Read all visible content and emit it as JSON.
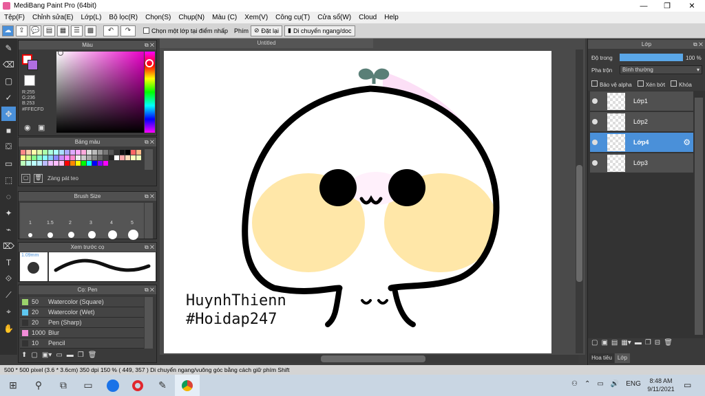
{
  "window": {
    "title": "MediBang Paint Pro (64bit)"
  },
  "menu": [
    "Tệp(F)",
    "Chỉnh sửa(E)",
    "Lớp(L)",
    "Bộ lọc(R)",
    "Chọn(S)",
    "Chụp(N)",
    "Màu (C)",
    "Xem(V)",
    "Công cụ(T)",
    "Cửa sổ(W)",
    "Cloud",
    "Help"
  ],
  "toolbar": {
    "checkbox_label": "Chọn một lớp tại điểm nhấp",
    "phim_label": "Phím",
    "reset_label": "Đặt lại",
    "move_label": "Di chuyển ngang/doc"
  },
  "color_panel": {
    "title": "Màu",
    "r": "R:255",
    "g": "G:236",
    "b": "B:253",
    "hex": "#FFECFD",
    "primary_color": "#ffecfd"
  },
  "palette_panel": {
    "title": "Bảng màu",
    "add_label": "Zàng pát teo"
  },
  "brush_size_panel": {
    "title": "Brush Size",
    "sizes": [
      "1",
      "1.5",
      "2",
      "3",
      "4",
      "5"
    ]
  },
  "preview_panel": {
    "title": "Xem trước cọ",
    "size": "1.09mm"
  },
  "brush_panel": {
    "title": "Cọ: Pen",
    "items": [
      {
        "size": "50",
        "name": "Watercolor (Square)",
        "color": "#9bd36b"
      },
      {
        "size": "20",
        "name": "Watercolor (Wet)",
        "color": "#5ec7f0"
      },
      {
        "size": "20",
        "name": "Pen (Sharp)",
        "color": "#333333"
      },
      {
        "size": "1000",
        "name": "Blur",
        "color": "#f28cd8"
      },
      {
        "size": "10",
        "name": "Pencil",
        "color": "#333333"
      }
    ]
  },
  "document": {
    "tab_title": "Untitled",
    "text_line1": "HuynhThienn",
    "text_line2": "#Hoidap247"
  },
  "layer_panel": {
    "title": "Lớp",
    "opacity_label": "Độ trong",
    "opacity_value": "100 %",
    "opacity_fraction": 1.0,
    "blend_label": "Pha trộn",
    "blend_value": "Bình thường",
    "protect_alpha": "Bảo vệ alpha",
    "clip": "Xén bớt",
    "lock": "Khóa",
    "layers": [
      "Lớp1",
      "Lớp2",
      "Lớp4",
      "Lớp3"
    ],
    "selected": "Lớp4",
    "tabs": [
      "Hoa tiêu",
      "Lớp"
    ]
  },
  "status": {
    "text": "500 * 500 pixel   (3.6 * 3.6cm)   350 dpi   150 %   ( 449, 357 )   Di chuyển ngang/vuông góc bằng cách giữ phím Shift"
  },
  "taskbar": {
    "language": "ENG",
    "time": "8:48 AM",
    "date": "9/11/2021"
  }
}
